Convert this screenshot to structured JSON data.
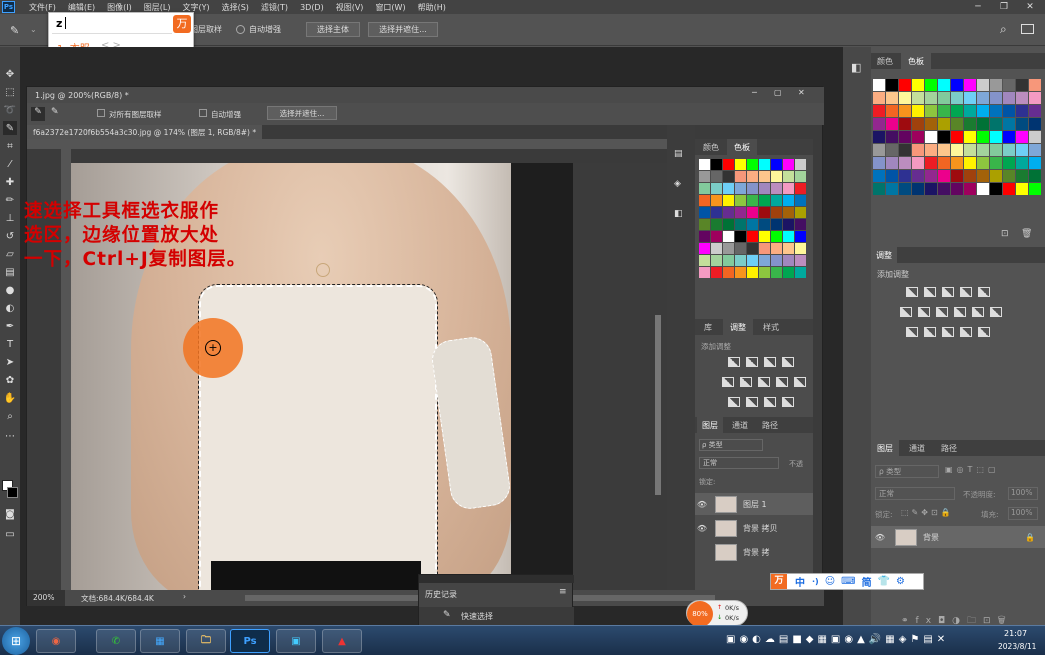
{
  "menu": {
    "logo": "Ps",
    "items": [
      "文件(F)",
      "编辑(E)",
      "图像(I)",
      "图层(L)",
      "文字(Y)",
      "选择(S)",
      "滤镜(T)",
      "3D(D)",
      "视图(V)",
      "窗口(W)",
      "帮助(H)"
    ]
  },
  "options": {
    "sample_all": "图层取样",
    "auto_enhance": "自动增强",
    "select_subject": "选择主体",
    "select_mask": "选择并遮住..."
  },
  "ime": {
    "input": "z",
    "candidate": "1. 衣服",
    "nav": "< >"
  },
  "doc_outer": {
    "title": "1.jpg @ 200%(RGB/8) *",
    "zoom": "200%",
    "doc_size": "文档:684.4K/684.4K"
  },
  "doc_inner": {
    "tab": "f6a2372e1720f6b554a3c30.jpg @ 174% (图层 1, RGB/8#) *",
    "sample_all": "对所有图层取样",
    "auto_enhance": "自动增强",
    "select_mask": "选择并遮住..."
  },
  "annotation": [
    "速选择工具框选衣服作",
    "选区，边缘位置放大处",
    "一下，Ctrl+J复制图层。"
  ],
  "inner_panel": {
    "color_tab": "颜色",
    "swatch_tab": "色板",
    "lib_tab": "库",
    "adj_tab": "调整",
    "style_tab": "样式",
    "add_adjust": "添加调整",
    "layers_tab": "图层",
    "channels_tab": "通道",
    "paths_tab": "路径",
    "kind": "ρ 类型",
    "mode": "正常",
    "opacity": "不透",
    "lock": "锁定:",
    "layers": [
      "图层 1",
      "背景 拷贝",
      "背景 拷"
    ]
  },
  "right_panel": {
    "color_tab": "颜色",
    "swatch_tab": "色板",
    "adj_title": "调整",
    "add_adjust": "添加调整",
    "layers_tab": "图层",
    "channels_tab": "通道",
    "paths_tab": "路径",
    "kind": "ρ 类型",
    "mode": "正常",
    "opacity_label": "不透明度:",
    "opacity": "100%",
    "lock": "锁定:",
    "fill_label": "填充:",
    "fill": "100%",
    "layer": "背景"
  },
  "history": {
    "title": "历史记录",
    "item": "快速选择"
  },
  "ime_bar": {
    "items": [
      "中",
      "·)",
      "☺",
      "⌨",
      "简",
      "👕",
      "⚙"
    ]
  },
  "net": {
    "badge": "80%",
    "up": "0K/s",
    "down": "0K/s"
  },
  "taskbar": {
    "time": "21:07",
    "date": "2023/8/11",
    "apps": [
      "◉",
      "✆",
      "▦",
      "🗀",
      "Ps",
      "▣",
      "▲"
    ]
  },
  "colors": {
    "annotation": "#d40000",
    "ime_orange": "#f26b21",
    "accent": "#1a6be0"
  }
}
